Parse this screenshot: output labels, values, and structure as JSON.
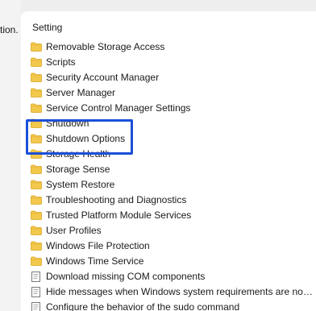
{
  "left_pane": {
    "clipped_text": "tion."
  },
  "list": {
    "header": "Setting",
    "items": [
      {
        "label": "Removable Storage Access",
        "icon": "folder-icon"
      },
      {
        "label": "Scripts",
        "icon": "folder-icon"
      },
      {
        "label": "Security Account Manager",
        "icon": "folder-icon"
      },
      {
        "label": "Server Manager",
        "icon": "folder-icon"
      },
      {
        "label": "Service Control Manager Settings",
        "icon": "folder-icon"
      },
      {
        "label": "Shutdown",
        "icon": "folder-icon"
      },
      {
        "label": "Shutdown Options",
        "icon": "folder-icon"
      },
      {
        "label": "Storage Health",
        "icon": "folder-icon"
      },
      {
        "label": "Storage Sense",
        "icon": "folder-icon"
      },
      {
        "label": "System Restore",
        "icon": "folder-icon"
      },
      {
        "label": "Troubleshooting and Diagnostics",
        "icon": "folder-icon"
      },
      {
        "label": "Trusted Platform Module Services",
        "icon": "folder-icon"
      },
      {
        "label": "User Profiles",
        "icon": "folder-icon"
      },
      {
        "label": "Windows File Protection",
        "icon": "folder-icon"
      },
      {
        "label": "Windows Time Service",
        "icon": "folder-icon"
      },
      {
        "label": "Download missing COM components",
        "icon": "policy-setting-icon"
      },
      {
        "label": "Hide messages when Windows system requirements are not...",
        "icon": "policy-setting-icon"
      },
      {
        "label": "Configure the behavior of the sudo command",
        "icon": "policy-setting-icon"
      }
    ]
  },
  "colors": {
    "highlight": "#1b4fd8",
    "folder": "#f2c94c"
  }
}
